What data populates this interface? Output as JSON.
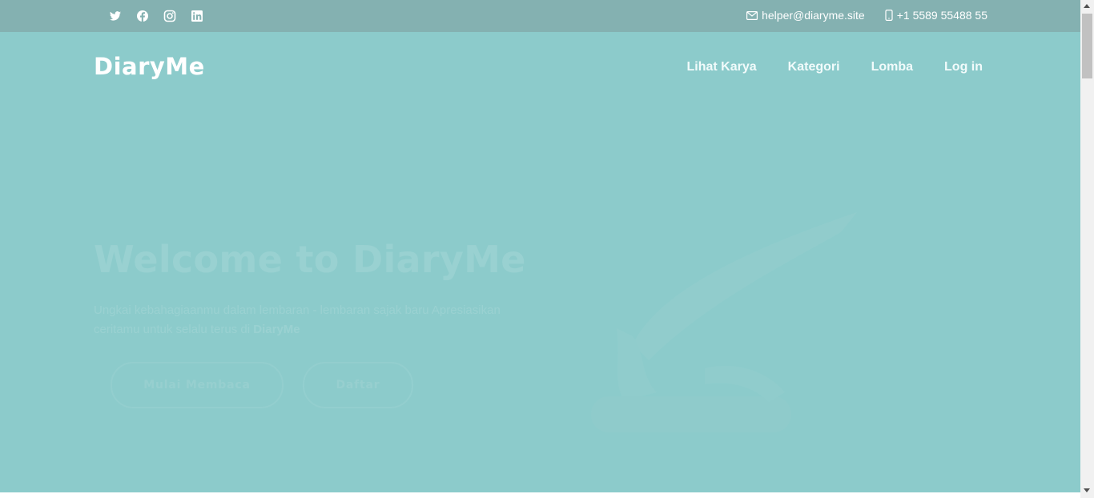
{
  "topbar": {
    "social_icons": [
      "twitter-icon",
      "facebook-icon",
      "instagram-icon",
      "linkedin-icon"
    ],
    "email": "helper@diaryme.site",
    "phone": "+1 5589 55488 55"
  },
  "header": {
    "logo": "DiaryMe",
    "nav": [
      "Lihat Karya",
      "Kategori",
      "Lomba",
      "Log in"
    ]
  },
  "hero": {
    "title": "Welcome to DiaryMe",
    "text": "Ungkai kebahagiaanmu dalam lembaran - lembaran sajak baru Apresiasikan ceritamu untuk selalu terus di",
    "text_brand": "DiaryMe",
    "button_primary": "Mulai Membaca",
    "button_secondary": "Daftar"
  },
  "colors": {
    "background": "#8ccbcb",
    "topbar": "#84b1b1"
  }
}
